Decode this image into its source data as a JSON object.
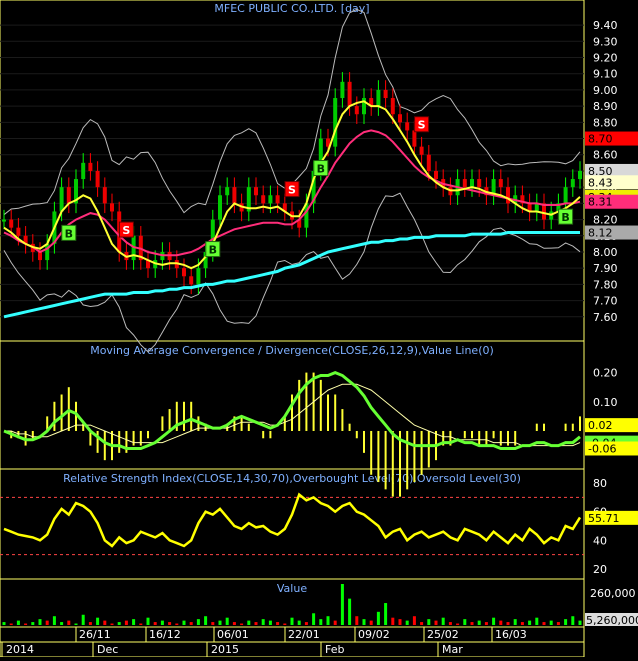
{
  "chart_data": [
    {
      "type": "candlestick",
      "title": "MFEC PUBLIC CO.,LTD. [day]",
      "ylim": [
        7.5,
        9.45
      ],
      "y_ticks": [
        "9.40",
        "9.30",
        "9.20",
        "9.10",
        "9.00",
        "8.90",
        "8.80",
        "8.70",
        "8.60",
        "8.50",
        "8.40",
        "8.30",
        "8.20",
        "8.10",
        "8.00",
        "7.90",
        "7.80",
        "7.70",
        "7.60"
      ],
      "price_labels": [
        {
          "text": "8.70",
          "value": 8.7,
          "color": "#ff0000"
        },
        {
          "text": "8.50",
          "value": 8.5,
          "color": "#d8d8d8"
        },
        {
          "text": "8.43",
          "value": 8.43,
          "color": "#ffffcc"
        },
        {
          "text": "8.34",
          "value": 8.34,
          "color": "#eeee00"
        },
        {
          "text": "8.31",
          "value": 8.31,
          "color": "#ff2d7a"
        },
        {
          "text": "8.12",
          "value": 8.12,
          "color": "#aaaaaa"
        }
      ],
      "close": [
        8.2,
        8.15,
        8.1,
        8.05,
        8.0,
        7.95,
        8.05,
        8.25,
        8.4,
        8.3,
        8.45,
        8.55,
        8.5,
        8.4,
        8.3,
        8.25,
        8.0,
        7.95,
        8.1,
        7.95,
        7.9,
        7.95,
        8.0,
        7.95,
        7.9,
        7.85,
        7.8,
        7.9,
        8.0,
        8.2,
        8.35,
        8.4,
        8.3,
        8.25,
        8.4,
        8.35,
        8.3,
        8.35,
        8.3,
        8.25,
        8.2,
        8.15,
        8.3,
        8.5,
        8.7,
        8.65,
        8.95,
        9.05,
        8.9,
        8.85,
        8.95,
        8.9,
        9.0,
        8.95,
        8.85,
        8.8,
        8.75,
        8.65,
        8.6,
        8.5,
        8.45,
        8.4,
        8.35,
        8.45,
        8.4,
        8.45,
        8.4,
        8.35,
        8.45,
        8.4,
        8.3,
        8.35,
        8.3,
        8.25,
        8.3,
        8.2,
        8.25,
        8.3,
        8.4,
        8.45,
        8.5
      ],
      "ma_yellow": [
        8.15,
        8.12,
        8.08,
        8.05,
        8.03,
        8.02,
        8.05,
        8.15,
        8.25,
        8.3,
        8.32,
        8.35,
        8.33,
        8.25,
        8.15,
        8.05,
        8.0,
        7.97,
        7.98,
        7.97,
        7.95,
        7.93,
        7.92,
        7.93,
        7.93,
        7.92,
        7.9,
        7.92,
        7.97,
        8.05,
        8.15,
        8.25,
        8.3,
        8.28,
        8.27,
        8.27,
        8.28,
        8.27,
        8.28,
        8.25,
        8.22,
        8.22,
        8.3,
        8.45,
        8.55,
        8.62,
        8.75,
        8.85,
        8.9,
        8.92,
        8.93,
        8.9,
        8.9,
        8.88,
        8.82,
        8.75,
        8.68,
        8.6,
        8.53,
        8.47,
        8.43,
        8.4,
        8.38,
        8.38,
        8.39,
        8.4,
        8.39,
        8.37,
        8.36,
        8.35,
        8.33,
        8.3,
        8.27,
        8.25,
        8.25,
        8.24,
        8.23,
        8.25,
        8.27,
        8.3,
        8.34
      ],
      "ma_magenta": [
        8.12,
        8.1,
        8.07,
        8.05,
        8.03,
        8.0,
        8.02,
        8.06,
        8.12,
        8.17,
        8.2,
        8.22,
        8.24,
        8.23,
        8.2,
        8.15,
        8.1,
        8.06,
        8.03,
        8.02,
        8.0,
        7.99,
        7.98,
        7.98,
        7.98,
        7.99,
        8.0,
        8.02,
        8.05,
        8.08,
        8.1,
        8.12,
        8.14,
        8.15,
        8.16,
        8.17,
        8.18,
        8.18,
        8.18,
        8.17,
        8.17,
        8.2,
        8.25,
        8.32,
        8.4,
        8.47,
        8.55,
        8.61,
        8.67,
        8.71,
        8.74,
        8.75,
        8.74,
        8.72,
        8.68,
        8.63,
        8.58,
        8.53,
        8.49,
        8.46,
        8.44,
        8.42,
        8.41,
        8.4,
        8.39,
        8.38,
        8.37,
        8.36,
        8.35,
        8.34,
        8.33,
        8.32,
        8.31,
        8.3,
        8.3,
        8.29,
        8.29,
        8.29,
        8.3,
        8.3,
        8.31
      ],
      "ma_cyan": [
        7.6,
        7.61,
        7.62,
        7.63,
        7.64,
        7.65,
        7.66,
        7.67,
        7.68,
        7.69,
        7.7,
        7.71,
        7.72,
        7.73,
        7.74,
        7.74,
        7.74,
        7.74,
        7.75,
        7.75,
        7.75,
        7.76,
        7.76,
        7.77,
        7.77,
        7.78,
        7.78,
        7.79,
        7.8,
        7.8,
        7.81,
        7.82,
        7.82,
        7.83,
        7.84,
        7.85,
        7.86,
        7.87,
        7.88,
        7.9,
        7.91,
        7.92,
        7.94,
        7.96,
        7.98,
        8.0,
        8.01,
        8.02,
        8.03,
        8.04,
        8.05,
        8.06,
        8.06,
        8.07,
        8.07,
        8.08,
        8.08,
        8.09,
        8.09,
        8.09,
        8.1,
        8.1,
        8.1,
        8.1,
        8.1,
        8.11,
        8.11,
        8.11,
        8.11,
        8.11,
        8.12,
        8.12,
        8.12,
        8.12,
        8.12,
        8.12,
        8.12,
        8.12,
        8.12,
        8.12,
        8.12
      ],
      "signals": [
        {
          "text": "B",
          "index": 9,
          "type": "buy"
        },
        {
          "text": "S",
          "index": 17,
          "type": "sell"
        },
        {
          "text": "B",
          "index": 29,
          "type": "buy"
        },
        {
          "text": "S",
          "index": 40,
          "type": "sell"
        },
        {
          "text": "B",
          "index": 44,
          "type": "buy"
        },
        {
          "text": "S",
          "index": 58,
          "type": "sell"
        },
        {
          "text": "B",
          "index": 78,
          "type": "buy"
        }
      ]
    },
    {
      "type": "line",
      "title": "Moving Average Convergence / Divergence(CLOSE,26,12,9),Value Line(0)",
      "ylim": [
        -0.12,
        0.25
      ],
      "y_ticks": [
        "0.20",
        "0.10"
      ],
      "value_labels": [
        {
          "text": "0.02",
          "value": 0.02,
          "color": "#ffff00"
        },
        {
          "text": "-0.04",
          "value": -0.04,
          "color": "#66ff33"
        },
        {
          "text": "-0.06",
          "value": -0.06,
          "color": "#ffff00"
        }
      ],
      "macd": [
        0.0,
        -0.01,
        -0.02,
        -0.03,
        -0.03,
        -0.02,
        0.0,
        0.03,
        0.05,
        0.07,
        0.06,
        0.03,
        0.0,
        -0.02,
        -0.04,
        -0.05,
        -0.05,
        -0.06,
        -0.06,
        -0.06,
        -0.05,
        -0.04,
        -0.02,
        0.0,
        0.02,
        0.03,
        0.04,
        0.03,
        0.02,
        0.01,
        0.01,
        0.02,
        0.04,
        0.05,
        0.04,
        0.03,
        0.02,
        0.01,
        0.02,
        0.05,
        0.09,
        0.13,
        0.16,
        0.18,
        0.19,
        0.19,
        0.2,
        0.19,
        0.17,
        0.15,
        0.12,
        0.08,
        0.05,
        0.02,
        -0.01,
        -0.03,
        -0.04,
        -0.05,
        -0.05,
        -0.05,
        -0.05,
        -0.04,
        -0.04,
        -0.03,
        -0.04,
        -0.04,
        -0.05,
        -0.05,
        -0.05,
        -0.06,
        -0.06,
        -0.06,
        -0.05,
        -0.05,
        -0.04,
        -0.04,
        -0.05,
        -0.05,
        -0.04,
        -0.04,
        -0.02
      ],
      "signal": [
        0.0,
        0.0,
        -0.01,
        -0.01,
        -0.02,
        -0.02,
        -0.02,
        -0.01,
        0.0,
        0.01,
        0.02,
        0.02,
        0.02,
        0.01,
        0.0,
        -0.01,
        -0.02,
        -0.03,
        -0.04,
        -0.04,
        -0.04,
        -0.04,
        -0.04,
        -0.03,
        -0.02,
        -0.01,
        0.0,
        0.01,
        0.01,
        0.01,
        0.01,
        0.01,
        0.02,
        0.03,
        0.03,
        0.03,
        0.03,
        0.02,
        0.02,
        0.03,
        0.04,
        0.06,
        0.08,
        0.1,
        0.12,
        0.14,
        0.15,
        0.16,
        0.16,
        0.16,
        0.15,
        0.14,
        0.12,
        0.1,
        0.08,
        0.06,
        0.04,
        0.02,
        0.01,
        0.0,
        -0.01,
        -0.02,
        -0.02,
        -0.03,
        -0.03,
        -0.03,
        -0.03,
        -0.03,
        -0.04,
        -0.04,
        -0.04,
        -0.04,
        -0.05,
        -0.05,
        -0.05,
        -0.05,
        -0.05,
        -0.05,
        -0.05,
        -0.05,
        -0.04
      ]
    },
    {
      "type": "line",
      "title": "Relative Strength Index(CLOSE,14,30,70),Overbought Level(70),Oversold Level(30)",
      "ylim": [
        15,
        78
      ],
      "y_ticks": [
        "80",
        "60",
        "40",
        "20"
      ],
      "overbought": 70,
      "oversold": 30,
      "value_labels": [
        {
          "text": "55.71",
          "value": 55.71,
          "color": "#ffff00"
        }
      ],
      "rsi": [
        48,
        46,
        44,
        43,
        42,
        40,
        44,
        55,
        62,
        58,
        66,
        64,
        60,
        52,
        40,
        36,
        42,
        38,
        40,
        46,
        44,
        42,
        45,
        40,
        38,
        36,
        40,
        52,
        60,
        58,
        62,
        56,
        50,
        48,
        52,
        49,
        50,
        46,
        44,
        48,
        58,
        72,
        68,
        70,
        66,
        64,
        60,
        64,
        66,
        60,
        58,
        54,
        50,
        42,
        46,
        48,
        40,
        44,
        46,
        42,
        44,
        46,
        42,
        40,
        48,
        46,
        44,
        40,
        46,
        42,
        38,
        44,
        40,
        48,
        44,
        38,
        42,
        40,
        50,
        48,
        56
      ],
      "annotations": []
    },
    {
      "type": "bar",
      "title": "Value",
      "y_ticks": [
        "260,000",
        "5,260,000"
      ],
      "volume": [
        2,
        1,
        3,
        1,
        2,
        4,
        3,
        6,
        2,
        3,
        1,
        7,
        2,
        5,
        3,
        1,
        2,
        3,
        4,
        1,
        5,
        2,
        3,
        2,
        1,
        3,
        2,
        4,
        6,
        2,
        3,
        5,
        2,
        1,
        3,
        2,
        4,
        3,
        2,
        1,
        5,
        3,
        2,
        8,
        4,
        6,
        3,
        28,
        18,
        6,
        4,
        3,
        9,
        15,
        5,
        4,
        3,
        6,
        2,
        4,
        3,
        5,
        2,
        1,
        4,
        2,
        3,
        2,
        5,
        3,
        2,
        4,
        2,
        3,
        5,
        2,
        3,
        2,
        4,
        6,
        3
      ],
      "volume_up": [
        true,
        false,
        true,
        false,
        true,
        true,
        false,
        true,
        true,
        false,
        true,
        true,
        false,
        true,
        false,
        false,
        true,
        false,
        true,
        false,
        true,
        false,
        true,
        false,
        false,
        true,
        false,
        true,
        true,
        false,
        true,
        true,
        false,
        false,
        true,
        false,
        true,
        true,
        false,
        false,
        true,
        true,
        false,
        true,
        true,
        true,
        false,
        true,
        true,
        false,
        true,
        false,
        true,
        true,
        false,
        false,
        true,
        false,
        false,
        true,
        false,
        true,
        false,
        false,
        true,
        false,
        true,
        false,
        true,
        false,
        false,
        true,
        false,
        true,
        true,
        false,
        true,
        false,
        true,
        true,
        true
      ]
    }
  ],
  "axis": {
    "date_ticks": [
      "26/11",
      "16/12",
      "06/01",
      "22/01",
      "09/02",
      "25/02",
      "16/03"
    ],
    "period_labels": [
      "2014",
      "Dec",
      "2015",
      "Feb",
      "Mar"
    ]
  }
}
